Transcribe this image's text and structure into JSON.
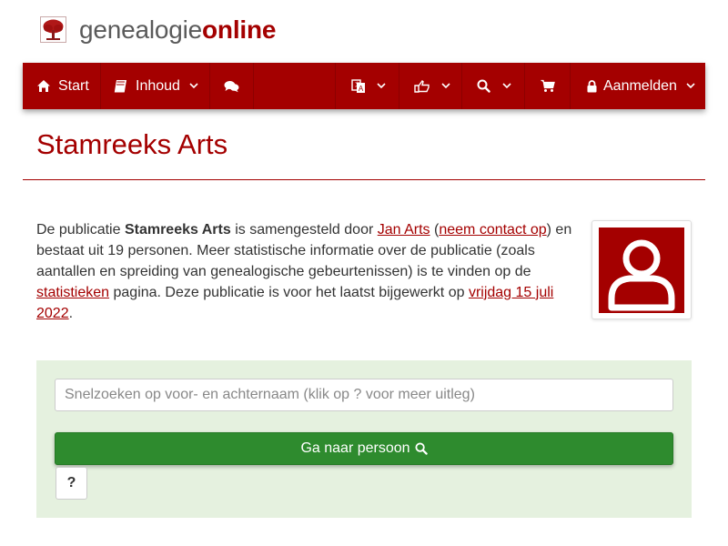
{
  "header": {
    "logo_part1": "genealogie",
    "logo_part2": "online",
    "logo_icon": "tree-icon"
  },
  "nav": {
    "start": {
      "label": "Start",
      "icon": "home-icon"
    },
    "inhoud": {
      "label": "Inhoud",
      "icon": "book-icon"
    },
    "comments": {
      "icon": "comments-icon"
    },
    "language": {
      "icon": "language-icon"
    },
    "share": {
      "icon": "share-icon"
    },
    "search": {
      "icon": "search-icon"
    },
    "cart": {
      "icon": "cart-icon"
    },
    "login": {
      "label": "Aanmelden",
      "icon": "lock-icon"
    }
  },
  "page": {
    "title": "Stamreeks Arts"
  },
  "intro": {
    "t1": "De publicatie ",
    "pub_name": "Stamreeks Arts",
    "t2": " is samengesteld door ",
    "author": "Jan Arts",
    "t3": " (",
    "contact": "neem contact op",
    "t4": ") en bestaat uit 19 personen. Meer statistische informatie over de publicatie (zoals aantallen en spreiding van genealogische gebeurtenissen) is te vinden op de ",
    "stats_link": "statistieken",
    "t5": " pagina. Deze publicatie is voor het laatst bijgewerkt op ",
    "date_link": "vrijdag 15 juli 2022",
    "t6": "."
  },
  "search": {
    "placeholder": "Snelzoeken op voor- en achternaam (klik op ? voor meer uitleg)",
    "button_label": "Ga naar persoon",
    "help_label": "?"
  },
  "colors": {
    "brand": "#a40000",
    "panel": "#e5f1df",
    "button": "#2e8b2e"
  }
}
